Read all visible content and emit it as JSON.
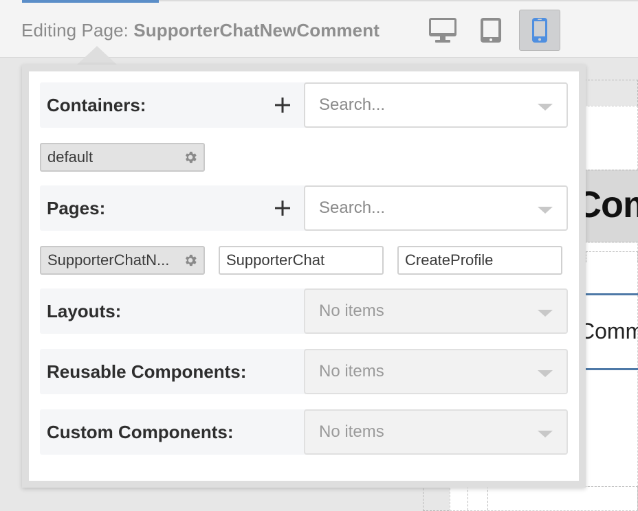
{
  "header": {
    "editing_label": "Editing Page:",
    "page_name": "SupporterChatNewComment",
    "devices": [
      {
        "name": "desktop",
        "icon": "desktop-icon",
        "active": false
      },
      {
        "name": "tablet",
        "icon": "tablet-icon",
        "active": false
      },
      {
        "name": "mobile",
        "icon": "mobile-icon",
        "active": true
      }
    ]
  },
  "popover": {
    "containers": {
      "label": "Containers:",
      "search_placeholder": "Search...",
      "items": [
        {
          "label": "default",
          "selected": true
        }
      ]
    },
    "pages": {
      "label": "Pages:",
      "search_placeholder": "Search...",
      "items": [
        {
          "label": "SupporterChatN...",
          "selected": true
        },
        {
          "label": "SupporterChat",
          "selected": false
        },
        {
          "label": "CreateProfile",
          "selected": false
        }
      ]
    },
    "layouts": {
      "label": "Layouts:",
      "placeholder": "No items"
    },
    "reusable_components": {
      "label": "Reusable Components:",
      "placeholder": "No items"
    },
    "custom_components": {
      "label": "Custom Components:",
      "placeholder": "No items"
    }
  },
  "canvas": {
    "heading_fragment": "Com",
    "comment_fragment": "Comm"
  },
  "colors": {
    "accent": "#5b8ec8",
    "active_device": "#4f8fe0",
    "icon_gray": "#8d8d8d"
  }
}
